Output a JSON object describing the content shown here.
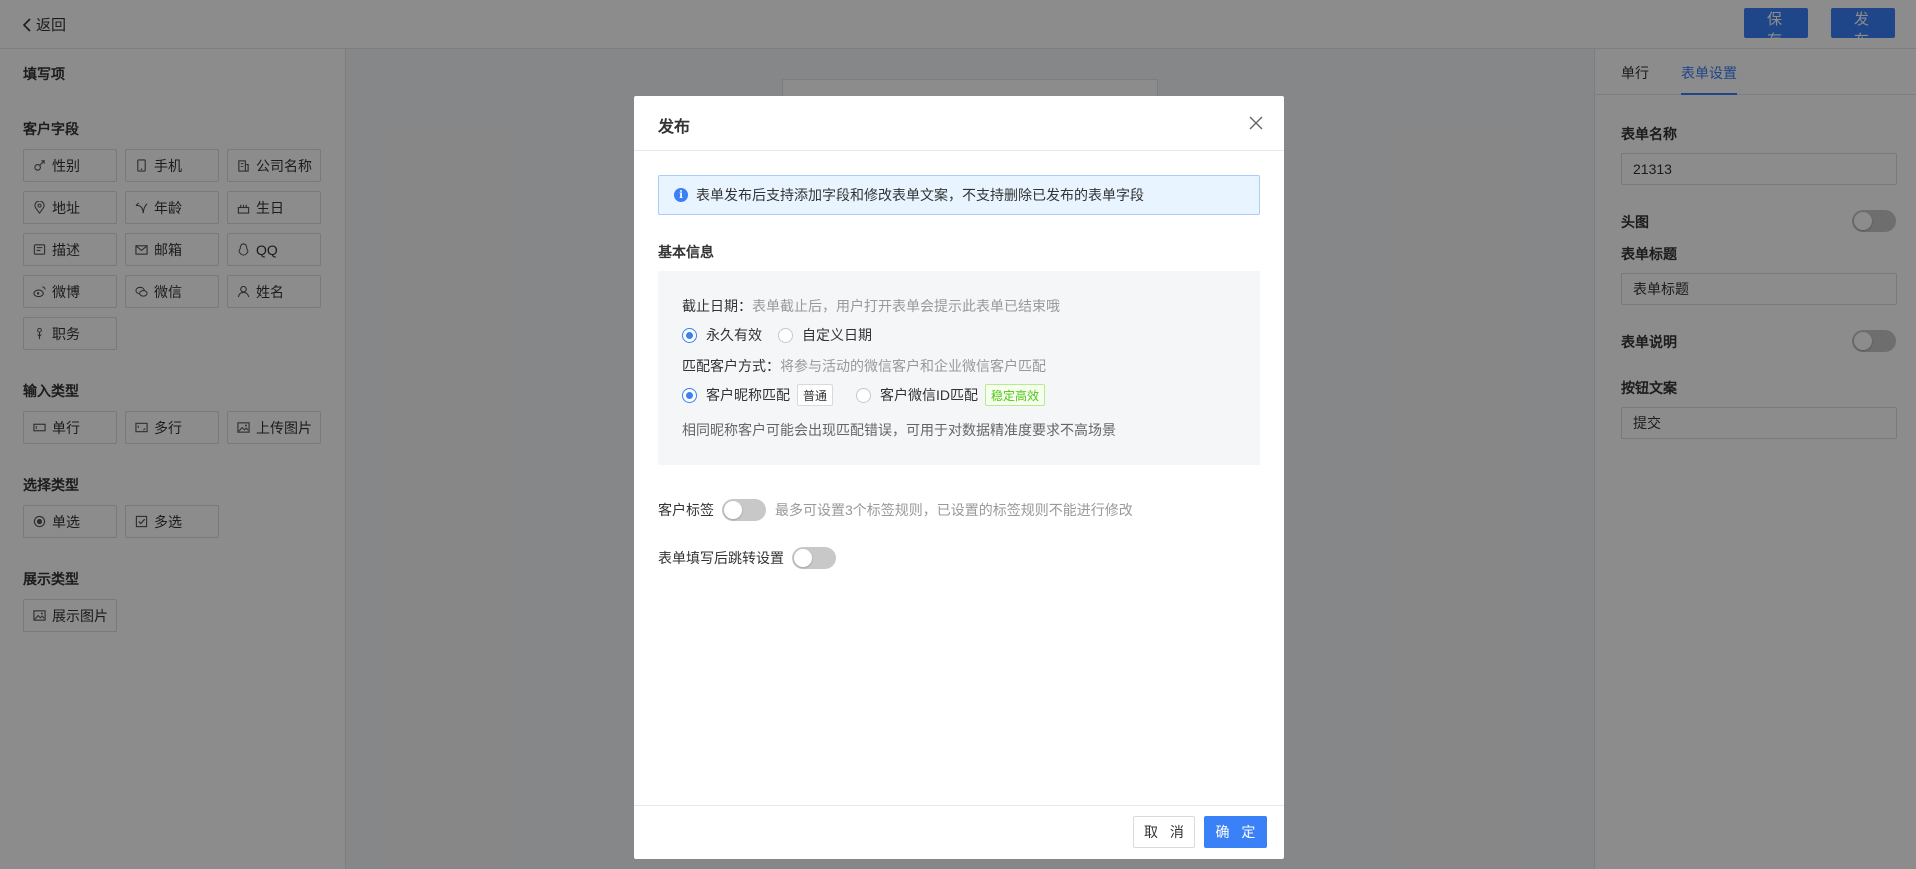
{
  "topbar": {
    "back_label": "返回",
    "save_label": "保 存",
    "publish_label": "发 布"
  },
  "left_panel": {
    "title": "填写项",
    "customer_fields": {
      "title": "客户字段",
      "items": [
        {
          "label": "性别",
          "icon": "gender-icon"
        },
        {
          "label": "手机",
          "icon": "phone-icon"
        },
        {
          "label": "公司名称",
          "icon": "building-icon"
        },
        {
          "label": "地址",
          "icon": "location-icon"
        },
        {
          "label": "年龄",
          "icon": "age-icon"
        },
        {
          "label": "生日",
          "icon": "cake-icon"
        },
        {
          "label": "描述",
          "icon": "description-icon"
        },
        {
          "label": "邮箱",
          "icon": "mail-icon"
        },
        {
          "label": "QQ",
          "icon": "qq-icon"
        },
        {
          "label": "微博",
          "icon": "weibo-icon"
        },
        {
          "label": "微信",
          "icon": "wechat-icon"
        },
        {
          "label": "姓名",
          "icon": "user-icon"
        },
        {
          "label": "职务",
          "icon": "job-icon"
        }
      ]
    },
    "input_types": {
      "title": "输入类型",
      "items": [
        {
          "label": "单行",
          "icon": "single-line-icon"
        },
        {
          "label": "多行",
          "icon": "multi-line-icon"
        },
        {
          "label": "上传图片",
          "icon": "image-upload-icon"
        }
      ]
    },
    "choice_types": {
      "title": "选择类型",
      "items": [
        {
          "label": "单选",
          "icon": "radio-icon"
        },
        {
          "label": "多选",
          "icon": "checkbox-icon"
        }
      ]
    },
    "display_types": {
      "title": "展示类型",
      "items": [
        {
          "label": "展示图片",
          "icon": "image-icon"
        }
      ]
    }
  },
  "right_panel": {
    "tabs": [
      {
        "label": "单行"
      },
      {
        "label": "表单设置",
        "active": true
      }
    ],
    "form_name_label": "表单名称",
    "form_name_value": "21313",
    "header_image_label": "头图",
    "form_title_label": "表单标题",
    "form_title_value": "表单标题",
    "form_desc_label": "表单说明",
    "button_text_label": "按钮文案",
    "button_text_value": "提交"
  },
  "modal": {
    "title": "发布",
    "notice": "表单发布后支持添加字段和修改表单文案，不支持删除已发布的表单字段",
    "basic_info_title": "基本信息",
    "deadline_label": "截止日期：",
    "deadline_hint": "表单截止后，用户打开表单会提示此表单已结束哦",
    "deadline_options": [
      {
        "label": "永久有效",
        "checked": true
      },
      {
        "label": "自定义日期",
        "checked": false
      }
    ],
    "match_label": "匹配客户方式：",
    "match_hint": "将参与活动的微信客户和企业微信客户匹配",
    "match_options": [
      {
        "label": "客户昵称匹配",
        "tag": "普通",
        "checked": true
      },
      {
        "label": "客户微信ID匹配",
        "tag": "稳定高效",
        "checked": false
      }
    ],
    "match_note": "相同昵称客户可能会出现匹配错误，可用于对数据精准度要求不高场景",
    "customer_tag_label": "客户标签",
    "customer_tag_hint": "最多可设置3个标签规则，已设置的标签规则不能进行修改",
    "redirect_label": "表单填写后跳转设置",
    "cancel_label": "取 消",
    "ok_label": "确 定"
  },
  "colors": {
    "primary": "#3a80f7",
    "mask": "rgba(0,0,0,0.45)",
    "notice_bg": "#e8f4ff",
    "success": "#52c41a"
  }
}
